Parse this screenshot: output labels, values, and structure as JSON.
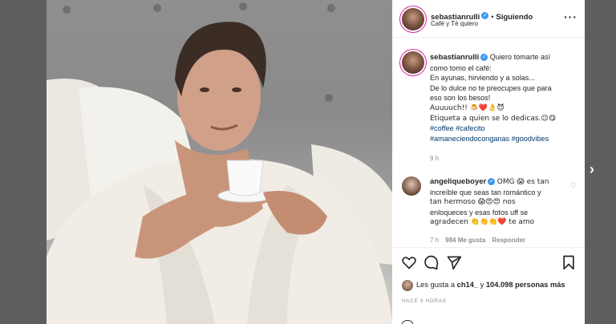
{
  "post": {
    "username": "sebastianrulli",
    "follow_status": "Siguiendo",
    "location": "Café y Té quiero",
    "more_icon": "more-options-icon"
  },
  "caption": {
    "username": "sebastianrulli",
    "lines": [
      "Quiero tomarte así",
      "como tomo el café:",
      "En ayunas, hirviendo y a solas...",
      "De lo dulce no te preocupes que para",
      "eso son los besos!",
      "Auuuuch!! 🍮❤️👌😈",
      "Etiqueta a quien se lo dedicas.😉😋"
    ],
    "hashtags_line1": "#coffee #cafecito",
    "hashtags_line2": "#amaneciendoconganas #goodvibes",
    "time": "9 h"
  },
  "comment": {
    "username": "angeliqueboyer",
    "lines": [
      "OMG 😱 es tan",
      "increíble que seas tan romántico y",
      "tan hermoso 😱😍😍 nos",
      "enloqueces y esas fotos uff se",
      "agradecen 👏👏👏❤️ te amo"
    ],
    "time": "7 h",
    "likes": "984 Me gusta",
    "reply": "Responder"
  },
  "likes": {
    "prefix": "Les gusta a",
    "user": "ch14_",
    "middle": "y",
    "count": "104.098 personas más"
  },
  "posted_ago": "HACE 9 HORAS",
  "colors": {
    "verified": "#3897f0",
    "hashtag": "#00376b",
    "muted": "#8e8e8e",
    "text": "#262626"
  }
}
